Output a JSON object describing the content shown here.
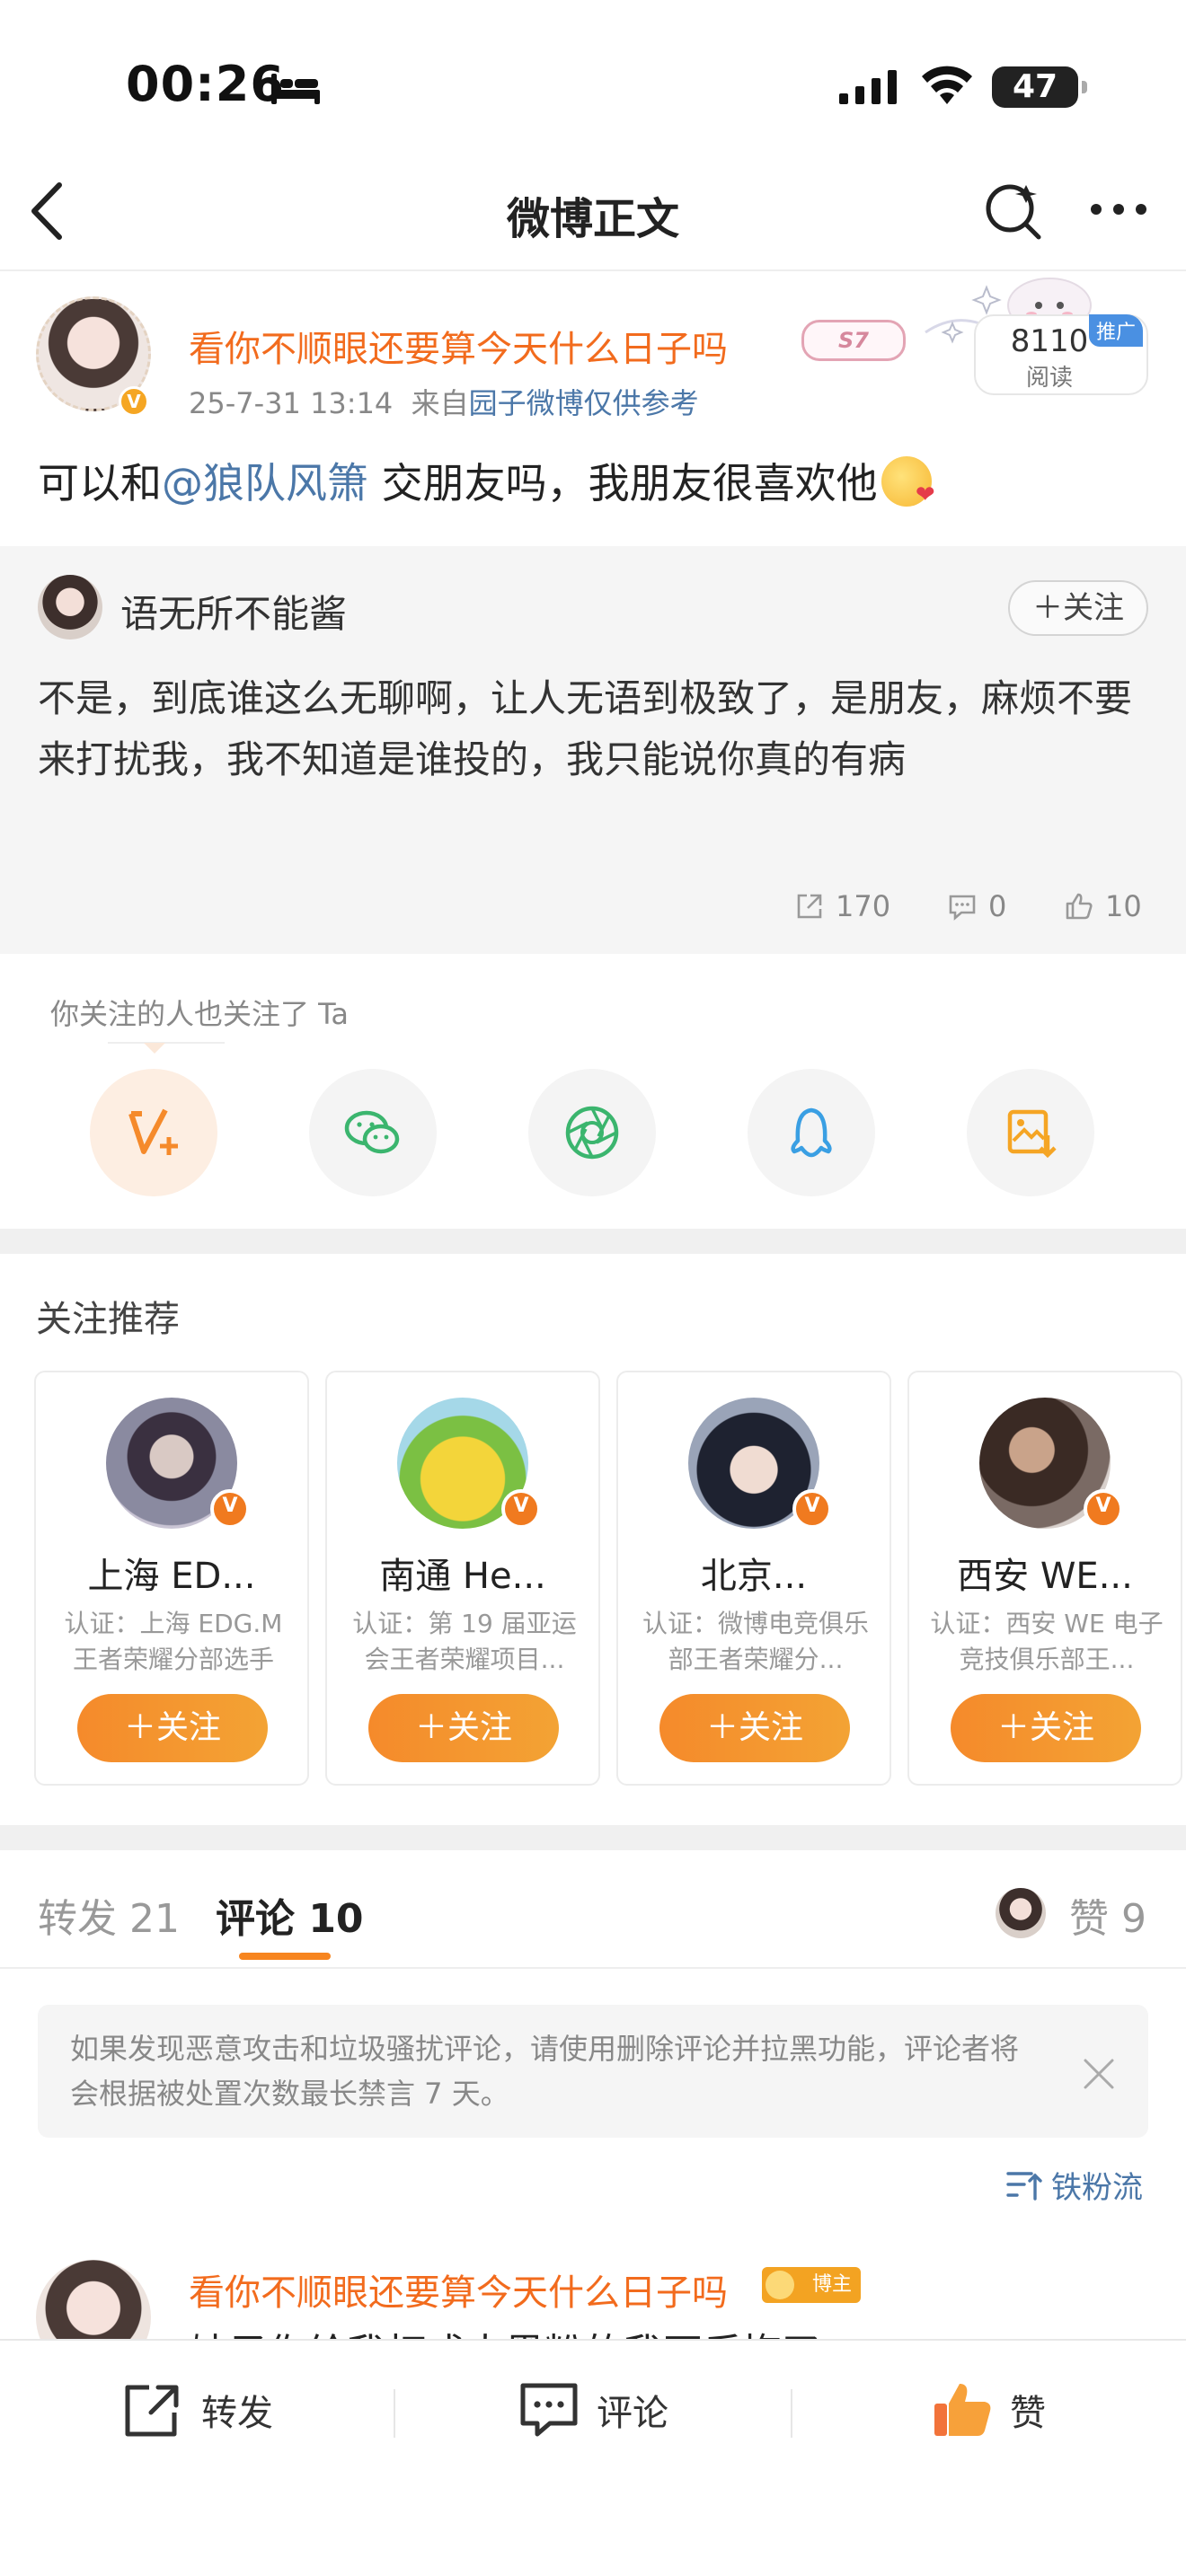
{
  "status_bar": {
    "time": "00:26",
    "battery": "47"
  },
  "nav": {
    "title": "微博正文"
  },
  "post": {
    "author": "看你不顺眼还要算今天什么日子吗",
    "name_sticker": "S7",
    "date": "25-7-31 13:14",
    "source_prefix": "来自",
    "source": "园子微博仅供参考",
    "reads": "8110",
    "reads_label": "阅读",
    "promo": "推广",
    "text_before": "可以和",
    "mention": "@狼队风箫",
    "text_after": " 交朋友吗，我朋友很喜欢他"
  },
  "retweet": {
    "author": "语无所不能酱",
    "follow": "关注",
    "text": "不是，到底谁这么无聊啊，让人无语到极致了，是朋友，麻烦不要来打扰我，我不知道是谁投的，我只能说你真的有病",
    "reposts": "170",
    "comments": "0",
    "likes": "10"
  },
  "share": {
    "hint": "你关注的人也关注了 Ta",
    "items": [
      "weibo-v-plus",
      "wechat",
      "moments",
      "qq",
      "save-image"
    ]
  },
  "recommend": {
    "title": "关注推荐",
    "follow_label": "关注",
    "users": [
      {
        "name": "上海 ED...",
        "desc": "认证：上海 EDG.M 王者荣耀分部选手"
      },
      {
        "name": "南通 He...",
        "desc": "认证：第 19 届亚运会王者荣耀项目..."
      },
      {
        "name": "北京...",
        "desc": "认证：微博电竞俱乐部王者荣耀分..."
      },
      {
        "name": "西安 WE...",
        "desc": "认证：西安 WE 电子竞技俱乐部王..."
      }
    ]
  },
  "tabs": {
    "repost": "转发 21",
    "comment": "评论 10",
    "like": "赞 9"
  },
  "notice": "如果发现恶意攻击和垃圾骚扰评论，请使用删除评论并拉黑功能，评论者将会根据被处置次数最长禁言 7 天。",
  "sort": "铁粉流",
  "first_comment": {
    "author": "看你不顺眼还要算今天什么日子吗",
    "badge": "博主",
    "preview": "妹子你给我打成大黑粉的我不后悔了"
  },
  "bottom": {
    "repost": "转发",
    "comment": "评论",
    "like": "赞"
  },
  "colors": {
    "accent": "#f7851f",
    "link": "#4b77a8",
    "name": "#f26b1d"
  }
}
